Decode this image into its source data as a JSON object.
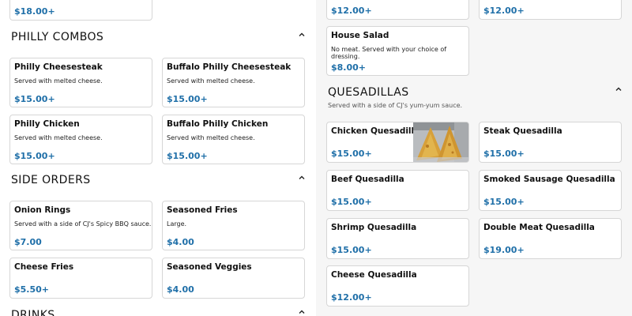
{
  "left": {
    "top_card": {
      "price": "$18.00+"
    },
    "philly": {
      "title": "PHILLY COMBOS",
      "items": [
        {
          "name": "Philly Cheesesteak",
          "desc": "Served with melted cheese.",
          "price": "$15.00+"
        },
        {
          "name": "Buffalo Philly Cheesesteak",
          "desc": "Served with melted cheese.",
          "price": "$15.00+"
        },
        {
          "name": "Philly Chicken",
          "desc": "Served with melted cheese.",
          "price": "$15.00+"
        },
        {
          "name": "Buffalo Philly Chicken",
          "desc": "Served with melted cheese.",
          "price": "$15.00+"
        }
      ]
    },
    "sides": {
      "title": "SIDE ORDERS",
      "items": [
        {
          "name": "Onion Rings",
          "desc": "Served with a side of CJ's Spicy BBQ sauce.",
          "price": "$7.00"
        },
        {
          "name": "Seasoned Fries",
          "desc": "Large.",
          "price": "$4.00"
        },
        {
          "name": "Cheese Fries",
          "price": "$5.50+"
        },
        {
          "name": "Seasoned Veggies",
          "price": "$4.00"
        }
      ]
    },
    "drinks": {
      "title": "DRINKS"
    }
  },
  "right": {
    "top_cards": [
      {
        "price": "$12.00+"
      },
      {
        "price": "$12.00+"
      }
    ],
    "house_salad": {
      "name": "House Salad",
      "desc": "No meat. Served with your choice of dressing.",
      "price": "$8.00+"
    },
    "quesadillas": {
      "title": "QUESADILLAS",
      "subtitle": "Served with a side of CJ's yum-yum sauce.",
      "items": [
        {
          "name": "Chicken Quesadilla",
          "price": "$15.00+"
        },
        {
          "name": "Steak Quesadilla",
          "price": "$15.00+"
        },
        {
          "name": "Beef Quesadilla",
          "price": "$15.00+"
        },
        {
          "name": "Smoked Sausage Quesadilla",
          "price": "$15.00+"
        },
        {
          "name": "Shrimp Quesadilla",
          "price": "$15.00+"
        },
        {
          "name": "Double Meat Quesadilla",
          "price": "$19.00+"
        },
        {
          "name": "Cheese Quesadilla",
          "price": "$12.00+"
        }
      ]
    }
  },
  "icons": {
    "collapse": "chevron-up-icon",
    "photo": "quesadilla-photo"
  },
  "colors": {
    "price": "#1f6fa8",
    "border": "#d6d6d6"
  }
}
